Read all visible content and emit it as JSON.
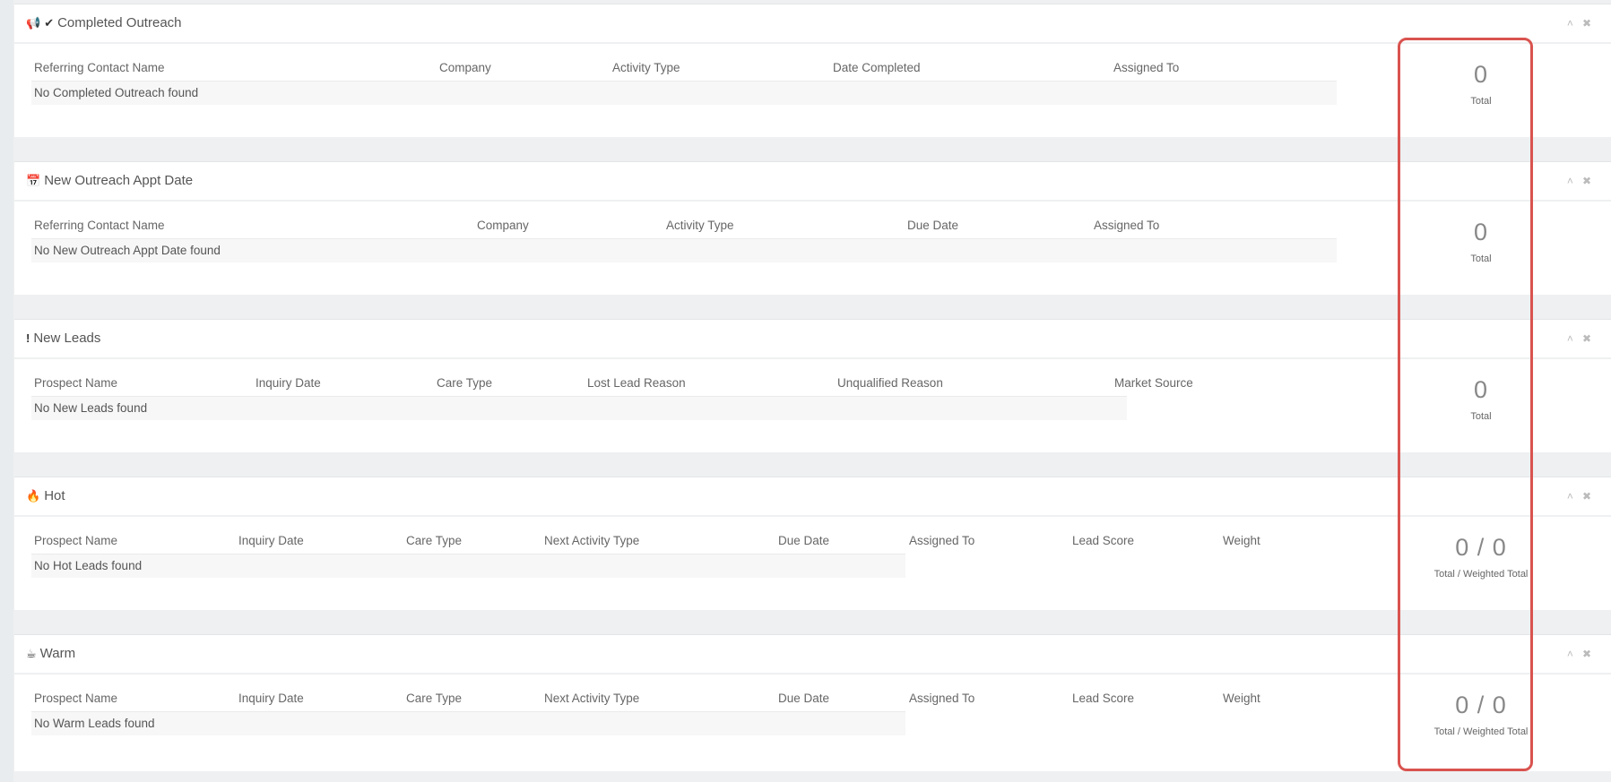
{
  "panels": [
    {
      "id": "completed-outreach",
      "title": "Completed Outreach",
      "icons": [
        "bullhorn-icon",
        "check-icon"
      ],
      "columns": [
        "Referring Contact Name",
        "Company",
        "Activity Type",
        "Date Completed",
        "Assigned To"
      ],
      "empty": "No Completed Outreach found",
      "stat_value": "0",
      "stat_label": "Total"
    },
    {
      "id": "new-outreach-appt-date",
      "title": "New Outreach Appt Date",
      "icons": [
        "calendar-icon"
      ],
      "columns": [
        "Referring Contact Name",
        "Company",
        "Activity Type",
        "Due Date",
        "Assigned To"
      ],
      "empty": "No New Outreach Appt Date found",
      "stat_value": "0",
      "stat_label": "Total"
    },
    {
      "id": "new-leads",
      "title": "New Leads",
      "icons": [
        "exclamation-icon"
      ],
      "columns": [
        "Prospect Name",
        "Inquiry Date",
        "Care Type",
        "Lost Lead Reason",
        "Unqualified Reason",
        "Market Source"
      ],
      "empty": "No New Leads found",
      "stat_value": "0",
      "stat_label": "Total"
    },
    {
      "id": "hot",
      "title": "Hot",
      "icons": [
        "fire-icon"
      ],
      "columns": [
        "Prospect Name",
        "Inquiry Date",
        "Care Type",
        "Next Activity Type",
        "Due Date",
        "Assigned To",
        "Lead Score",
        "Weight"
      ],
      "empty": "No Hot Leads found",
      "stat_value": "0 / 0",
      "stat_label": "Total / Weighted Total"
    },
    {
      "id": "warm",
      "title": "Warm",
      "icons": [
        "coffee-icon"
      ],
      "columns": [
        "Prospect Name",
        "Inquiry Date",
        "Care Type",
        "Next Activity Type",
        "Due Date",
        "Assigned To",
        "Lead Score",
        "Weight"
      ],
      "empty": "No Warm Leads found",
      "stat_value": "0 / 0",
      "stat_label": "Total / Weighted Total"
    }
  ],
  "tools": {
    "collapse": "˄",
    "close": "✖"
  },
  "colors": {
    "highlight": "#d9534f",
    "background": "#eef0f1"
  }
}
